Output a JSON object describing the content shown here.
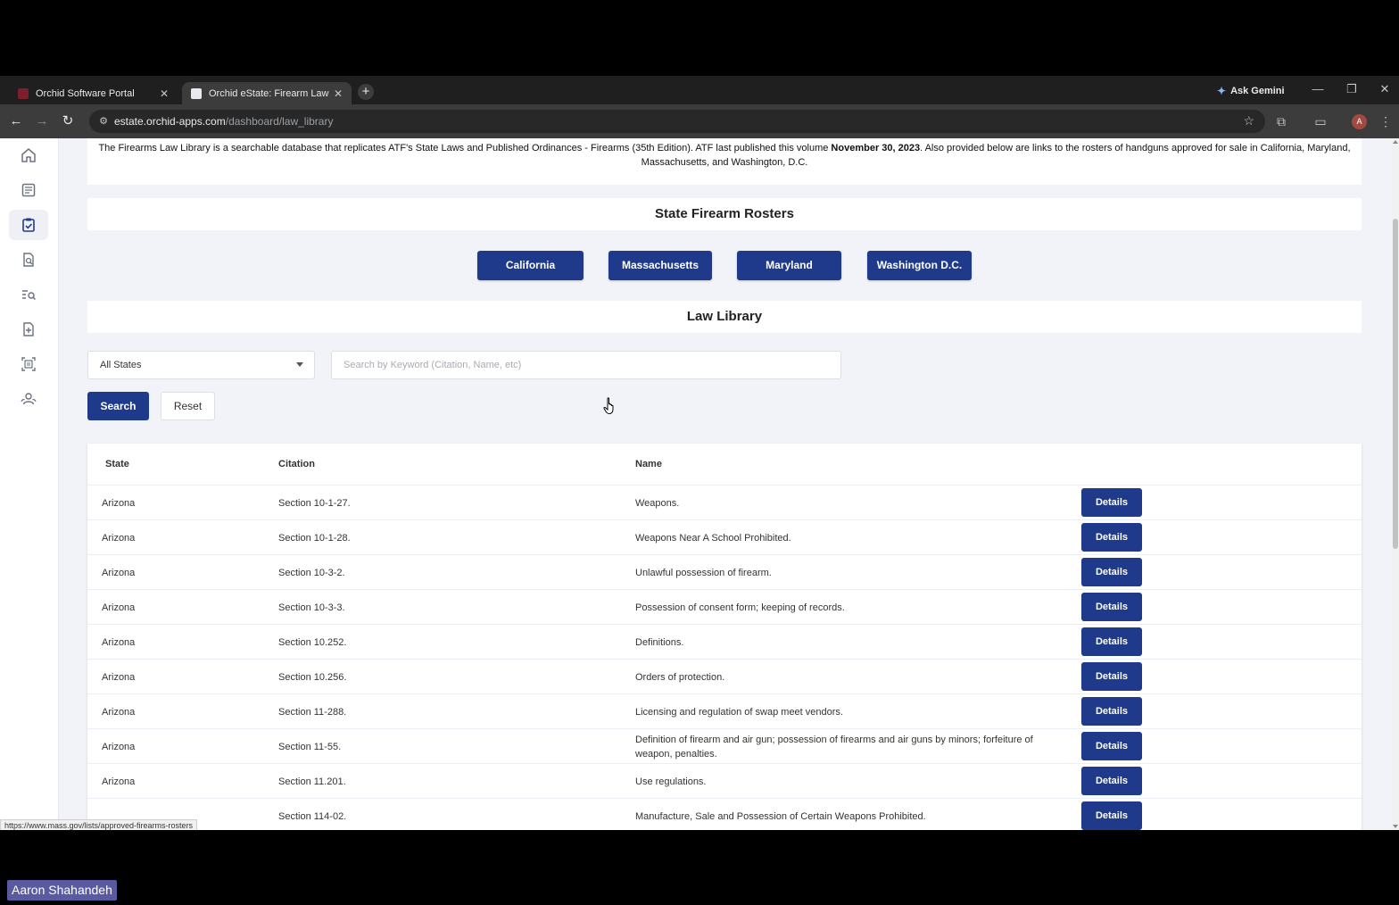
{
  "browser": {
    "tabs": [
      {
        "title": "Orchid Software Portal",
        "favicon_color": "#7a1f2b"
      },
      {
        "title": "Orchid eState: Firearm Law Libr...",
        "favicon_color": "#e8eaed"
      }
    ],
    "new_tab_icon": "+",
    "gemini_label": "Ask Gemini",
    "url_domain": "estate.orchid-apps.com",
    "url_path": "/dashboard/law_library",
    "profile_initial": "A"
  },
  "intro": {
    "text_part1": "The Firearms Law Library is a searchable database that replicates ATF's State Laws and Published Ordinances - Firearms (35th Edition). ATF last published this volume ",
    "text_bold": "November 30, 2023",
    "text_part2": ". Also provided below are links to the rosters of handguns approved for sale in California, Maryland, Massachusetts, and Washington, D.C."
  },
  "rosters": {
    "heading": "State Firearm Rosters",
    "buttons": [
      "California",
      "Massachusetts",
      "Maryland",
      "Washington D.C."
    ]
  },
  "library": {
    "heading": "Law Library",
    "state_select_value": "All States",
    "search_placeholder": "Search by Keyword (Citation, Name, etc)",
    "search_label": "Search",
    "reset_label": "Reset"
  },
  "table": {
    "columns": [
      "State",
      "Citation",
      "Name"
    ],
    "details_label": "Details",
    "rows": [
      {
        "state": "Arizona",
        "citation": "Section 10-1-27.",
        "name": "Weapons."
      },
      {
        "state": "Arizona",
        "citation": "Section 10-1-28.",
        "name": "Weapons Near A School Prohibited."
      },
      {
        "state": "Arizona",
        "citation": "Section 10-3-2.",
        "name": "Unlawful possession of firearm."
      },
      {
        "state": "Arizona",
        "citation": "Section 10-3-3.",
        "name": "Possession of consent form; keeping of records."
      },
      {
        "state": "Arizona",
        "citation": "Section 10.252.",
        "name": "Definitions."
      },
      {
        "state": "Arizona",
        "citation": "Section 10.256.",
        "name": "Orders of protection."
      },
      {
        "state": "Arizona",
        "citation": "Section 11-288.",
        "name": "Licensing and regulation of swap meet vendors."
      },
      {
        "state": "Arizona",
        "citation": "Section 11-55.",
        "name": "Definition of firearm and air gun; possession of firearms and air guns by minors; forfeiture of weapon, penalties."
      },
      {
        "state": "Arizona",
        "citation": "Section 11.201.",
        "name": "Use regulations."
      },
      {
        "state": "",
        "citation": "Section 114-02.",
        "name": "Manufacture, Sale and Possession of Certain Weapons Prohibited."
      }
    ]
  },
  "status_bar_url": "https://www.mass.gov/lists/approved-firearms-rosters",
  "presenter_name": "Aaron Shahandeh",
  "colors": {
    "primary": "#1f3a8a",
    "page_bg": "#f1f3f8"
  }
}
